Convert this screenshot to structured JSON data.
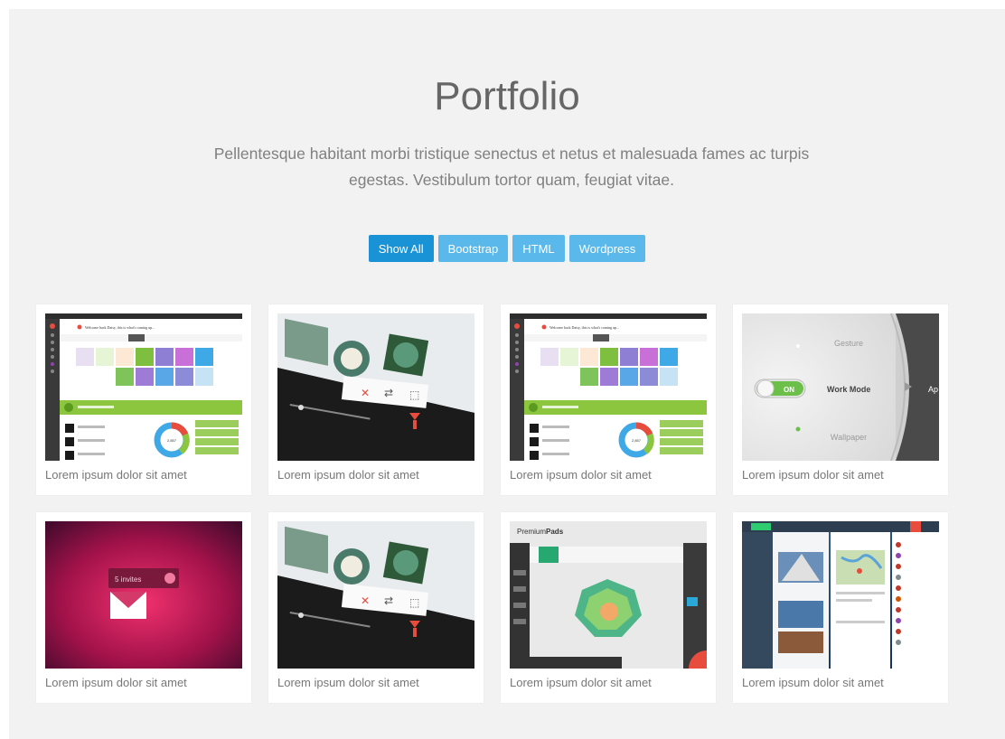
{
  "portfolio": {
    "title": "Portfolio",
    "subtitle": "Pellentesque habitant morbi tristique senectus et netus et malesuada fames ac turpis egestas. Vestibulum tortor quam, feugiat vitae.",
    "filters": [
      "Show All",
      "Bootstrap",
      "HTML",
      "Wordpress"
    ],
    "active_filter": "Show All",
    "items": [
      {
        "caption": "Lorem ipsum dolor sit amet",
        "image": "dashboard-screenshot"
      },
      {
        "caption": "Lorem ipsum dolor sit amet",
        "image": "music-player-screenshot"
      },
      {
        "caption": "Lorem ipsum dolor sit amet",
        "image": "dashboard-screenshot"
      },
      {
        "caption": "Lorem ipsum dolor sit amet",
        "image": "work-mode-dial"
      },
      {
        "caption": "Lorem ipsum dolor sit amet",
        "image": "invites-envelope"
      },
      {
        "caption": "Lorem ipsum dolor sit amet",
        "image": "music-player-screenshot"
      },
      {
        "caption": "Lorem ipsum dolor sit amet",
        "image": "premiumpods-radar"
      },
      {
        "caption": "Lorem ipsum dolor sit amet",
        "image": "social-dashboard"
      }
    ],
    "thumb_text": {
      "dashboard_welcome": "Welcome back Daisy, this is what's coming up...",
      "work_mode_on": "ON",
      "work_mode_label": "Work Mode",
      "gesture": "Gesture",
      "wallpaper": "Wallpaper",
      "ap_partial": "Ap",
      "invites": "5 invites",
      "premium_logo_a": "Premium",
      "premium_logo_b": "Pads",
      "donut_value": "2,857"
    }
  },
  "colors": {
    "background": "#f2f2f2",
    "card": "#ffffff",
    "filter_active": "#1a92d6",
    "filter": "#5ab8ea"
  }
}
